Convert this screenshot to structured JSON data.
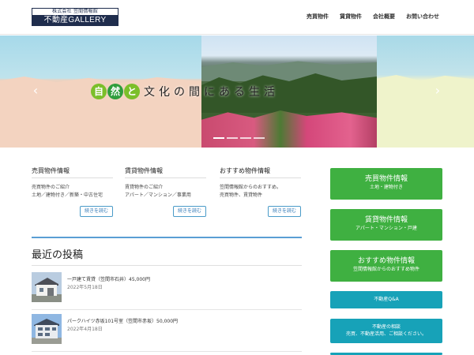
{
  "header": {
    "logo_company": "株式会社 笠間情報館",
    "logo_name": "不動産GALLERY",
    "nav": [
      "売買物件",
      "賃貸物件",
      "会社概要",
      "お問い合わせ"
    ]
  },
  "hero": {
    "circle_1": "自",
    "circle_2": "然",
    "circle_3": "と",
    "rest": "文化の間にある生活",
    "prev": "‹",
    "next": "›"
  },
  "columns": [
    {
      "title": "売買物件情報",
      "lines": [
        "売買物件のご紹介",
        "土地／建物付き／新築・中古住宅"
      ],
      "more": "続きを読む"
    },
    {
      "title": "賃貸物件情報",
      "lines": [
        "賃貸物件のご紹介",
        "アパート／マンション／事業用"
      ],
      "more": "続きを読む"
    },
    {
      "title": "おすすめ物件情報",
      "lines": [
        "笠間情報館からのおすすめ。",
        "売買物件、賃貸物件"
      ],
      "more": "続きを読む"
    }
  ],
  "recent": {
    "title": "最近の投稿",
    "posts": [
      {
        "title": "一戸建て賃貸（笠間市石井）45,000円",
        "date": "2022年5月18日"
      },
      {
        "title": "パークハイツ赤坂101号室（笠間市赤坂）50,000円",
        "date": "2022年4月18日"
      }
    ]
  },
  "sidebar": {
    "sale": {
      "title": "売買物件情報",
      "sub": "土地・建物付き"
    },
    "rent": {
      "title": "賃貸物件情報",
      "sub": "アパート・マンション・戸建"
    },
    "recommend": {
      "title": "おすすめ物件情報",
      "sub": "笠間情報館からのおすすめ物件"
    },
    "qa": {
      "title": "不動産Q&A"
    },
    "consult": {
      "title": "不動産の相談",
      "sub": "売買、不動産活用、ご相談ください。"
    }
  },
  "colors": {
    "green": "#3fb041",
    "teal": "#17a2b8",
    "navy": "#1f2d4d",
    "link_blue": "#337ab7"
  }
}
